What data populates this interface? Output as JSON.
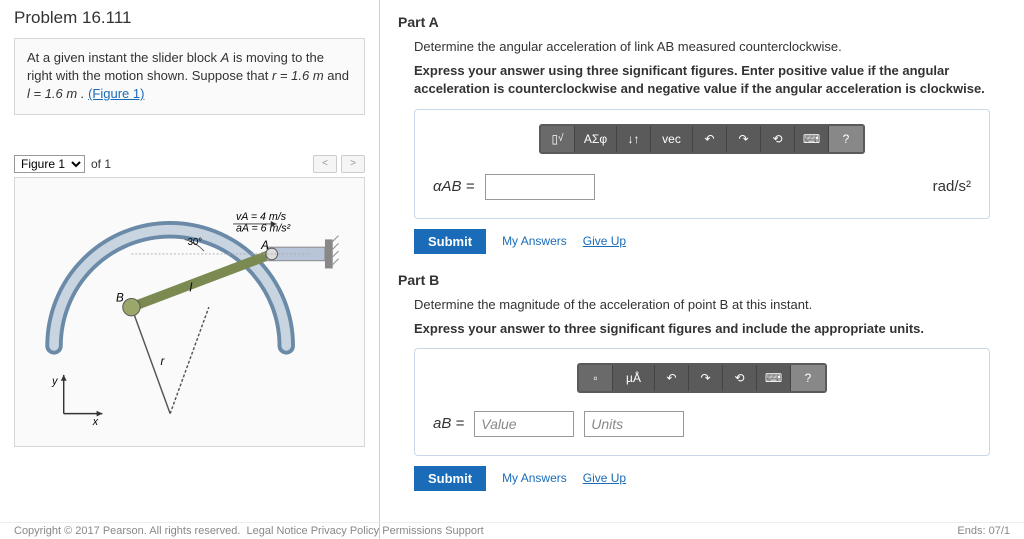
{
  "problem": {
    "title": "Problem 16.111",
    "statement_pre": "At a given instant the slider block ",
    "statement_var_A": "A",
    "statement_mid1": " is moving to the right with the motion shown. Suppose that ",
    "statement_r": "r = 1.6 m",
    "statement_mid2": " and ",
    "statement_l": "l = 1.6 m .",
    "figure_link": "(Figure 1)"
  },
  "figure": {
    "label": "Figure 1",
    "of_text": "of 1",
    "va": "vA = 4 m/s",
    "aa": "aA = 6 m/s²",
    "angle": "30°",
    "labelB": "B",
    "labelA": "A",
    "labelL": "l",
    "labelR": "r",
    "labelX": "x",
    "labelY": "y"
  },
  "partA": {
    "title": "Part A",
    "prompt": "Determine the angular acceleration of link AB measured counterclockwise.",
    "instructions": "Express your answer using three significant figures. Enter positive value if the angular acceleration is counterclockwise and negative value if the angular acceleration is clockwise.",
    "var_label": "αAB =",
    "unit": "rad/s²",
    "submit": "Submit",
    "my_answers": "My Answers",
    "give_up": "Give Up",
    "tools": {
      "t1": "√",
      "t2": "ΑΣφ",
      "t3": "↓↑",
      "t4": "vec",
      "undo": "↶",
      "redo": "↷",
      "reset": "⟲",
      "kb": "⌨",
      "help": "?"
    }
  },
  "partB": {
    "title": "Part B",
    "prompt": "Determine the magnitude of the acceleration of point B at this instant.",
    "instructions": "Express your answer to three significant figures and include the appropriate units.",
    "var_label": "aB =",
    "value_placeholder": "Value",
    "units_placeholder": "Units",
    "submit": "Submit",
    "my_answers": "My Answers",
    "give_up": "Give Up",
    "tools": {
      "t1": "▫",
      "t2": "µÅ",
      "undo": "↶",
      "redo": "↷",
      "reset": "⟲",
      "kb": "⌨",
      "help": "?"
    }
  },
  "footer": {
    "copyright": "Copyright © 2017 Pearson. All rights reserved.",
    "links": "Legal Notice   Privacy Policy   Permissions   Support",
    "ends": "Ends: 07/1"
  }
}
